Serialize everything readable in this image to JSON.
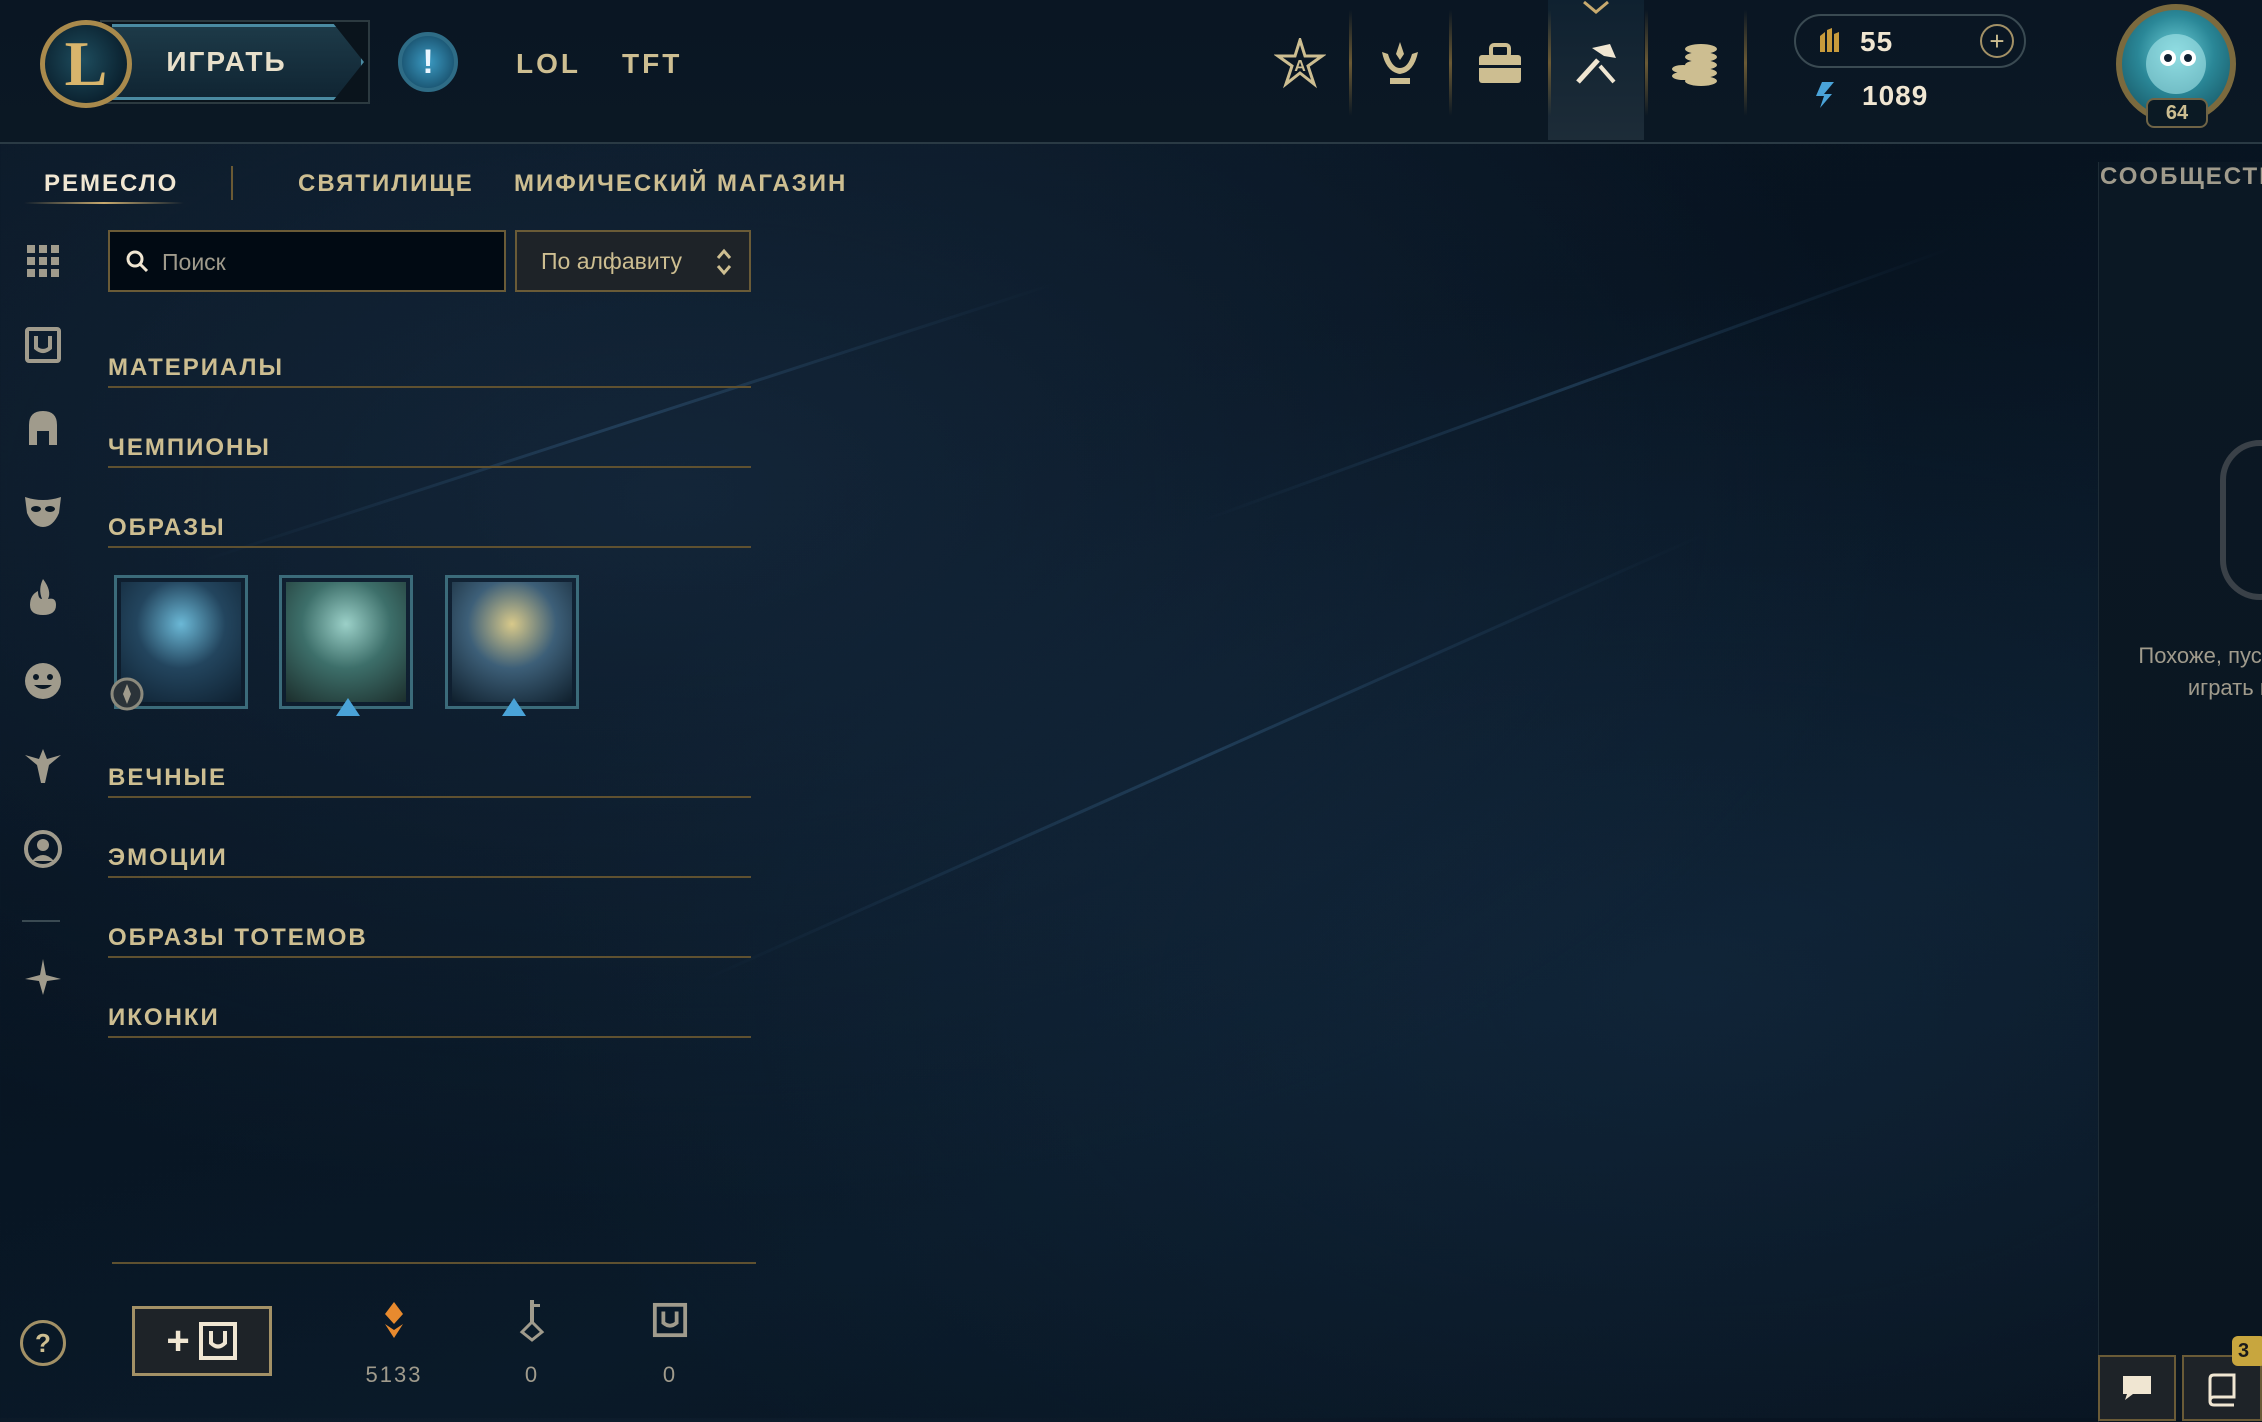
{
  "header": {
    "logo_letter": "L",
    "play_label": "ИГРАТЬ",
    "alert_symbol": "!",
    "modes": [
      "LOL",
      "TFT"
    ],
    "nav_icons": [
      "home-icon",
      "trophy-icon",
      "collection-bag-icon",
      "loot-craft-icon",
      "store-coins-icon"
    ],
    "active_nav": "loot-craft-icon",
    "currency": {
      "orange_essence": "55",
      "blue_essence": "1089",
      "add_symbol": "+"
    },
    "profile": {
      "level": "64"
    }
  },
  "subtabs": {
    "craft": "РЕМЕСЛО",
    "sanctum": "СВЯТИЛИЩЕ",
    "mythic_shop": "МИФИЧЕСКИЙ МАГАЗИН"
  },
  "community": {
    "title": "СООБЩЕСТВО",
    "empty_text": "Похоже, пуст. Доб играть и"
  },
  "sidebar": {
    "icons": [
      "grid-icon",
      "chest-icon",
      "helmet-icon",
      "mask-icon",
      "flame-icon",
      "emote-face-icon",
      "ward-icon",
      "profile-circle-icon",
      "wings-icon"
    ]
  },
  "filters": {
    "search_placeholder": "Поиск",
    "sort_label": "По алфавиту"
  },
  "categories": {
    "materials": "МАТЕРИАЛЫ",
    "champions": "ЧЕМПИОНЫ",
    "skins": "ОБРАЗЫ",
    "eternals": "ВЕЧНЫЕ",
    "emotes": "ЭМОЦИИ",
    "ward_skins": "ОБРАЗЫ ТОТЕМОВ",
    "icons": "ИКОНКИ"
  },
  "skins": [
    {
      "palette": [
        "#6bb8d6",
        "#23455e",
        "#0e2030"
      ]
    },
    {
      "palette": [
        "#9bd0c8",
        "#3d6f6a",
        "#1c2e2c"
      ]
    },
    {
      "palette": [
        "#d8c98a",
        "#3d5f78",
        "#0f1f2c"
      ]
    }
  ],
  "footer": {
    "help_symbol": "?",
    "add_chest_plus": "+",
    "resources": [
      {
        "name": "orange-essence",
        "value": "5133"
      },
      {
        "name": "key",
        "value": "0"
      },
      {
        "name": "chest",
        "value": "0"
      }
    ],
    "mission_badge": "3"
  },
  "colors": {
    "gold": "#c8aa6e",
    "gold_text": "#cdbe91",
    "blue_accent": "#0ac8b9",
    "background": "#010a13"
  }
}
